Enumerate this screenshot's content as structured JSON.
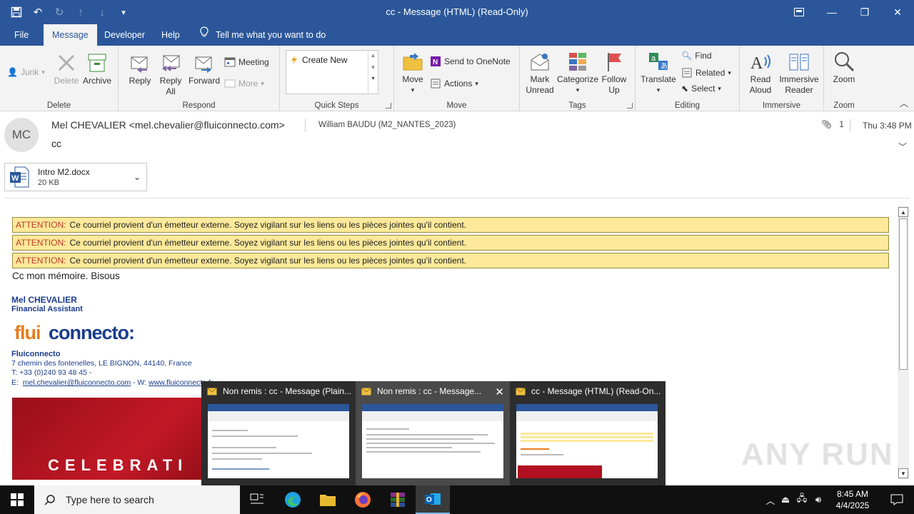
{
  "window": {
    "title": "cc  -  Message (HTML) (Read-Only)"
  },
  "menu": {
    "tabs": [
      "File",
      "Message",
      "Developer",
      "Help"
    ],
    "tell_me": "Tell me what you want to do"
  },
  "ribbon": {
    "delete_group": {
      "label": "Delete",
      "junk": "Junk",
      "delete": "Delete",
      "archive": "Archive"
    },
    "respond_group": {
      "label": "Respond",
      "reply": "Reply",
      "reply_all_1": "Reply",
      "reply_all_2": "All",
      "forward": "Forward",
      "meeting": "Meeting",
      "more": "More"
    },
    "quicksteps_group": {
      "label": "Quick Steps",
      "create_new": "Create New"
    },
    "move_group": {
      "label": "Move",
      "move": "Move",
      "send_onenote": "Send to OneNote",
      "actions": "Actions"
    },
    "tags_group": {
      "label": "Tags",
      "mark_unread_1": "Mark",
      "mark_unread_2": "Unread",
      "categorize": "Categorize",
      "follow_up_1": "Follow",
      "follow_up_2": "Up"
    },
    "editing_group": {
      "label": "Editing",
      "translate": "Translate",
      "find": "Find",
      "related": "Related",
      "select": "Select"
    },
    "immersive_group": {
      "label": "Immersive",
      "read_aloud_1": "Read",
      "read_aloud_2": "Aloud",
      "immersive_reader_1": "Immersive",
      "immersive_reader_2": "Reader"
    },
    "zoom_group": {
      "label": "Zoom",
      "zoom": "Zoom"
    }
  },
  "message": {
    "avatar_initials": "MC",
    "from": "Mel CHEVALIER <mel.chevalier@fluiconnecto.com>",
    "to": "William BAUDU (M2_NANTES_2023)",
    "subject": "cc",
    "attachment_count": "1",
    "date": "Thu 3:48 PM",
    "attachment": {
      "name": "Intro M2.docx",
      "size": "20 KB"
    }
  },
  "body": {
    "warning_label": "ATTENTION:",
    "warning_text": "Ce courriel provient d'un émetteur externe. Soyez vigilant sur les liens ou les pièces jointes qu'il contient.",
    "greeting": "Cc mon mémoire. Bisous",
    "signature": {
      "name": "Mel CHEVALIER",
      "title": "Financial Assistant",
      "company": "Fluiconnecto",
      "address": "7 chemin des fontenelles, LE BIGNON, 44140, France",
      "phone": "T:  +33 (0)240 93 48 45  -",
      "email_prefix": "E:",
      "email": "mel.chevalier@fluiconnecto.com",
      "web_prefix": " - W:",
      "web": "www.fluiconnecto.fr",
      "logo_text": "fluiconnecto"
    },
    "banner_text": "CELEBRATI"
  },
  "previews": [
    {
      "title": "Non remis : cc - Message (Plain..."
    },
    {
      "title": "Non remis : cc - Message..."
    },
    {
      "title": "cc - Message (HTML) (Read-On..."
    }
  ],
  "taskbar": {
    "search_placeholder": "Type here to search",
    "time": "8:45 AM",
    "date": "4/4/2025"
  },
  "watermark": "ANY RUN",
  "colors": {
    "accent": "#2b579a",
    "warning_bg": "#fce99a",
    "signature_blue": "#1a3c8c",
    "banner_red": "#c21826"
  }
}
